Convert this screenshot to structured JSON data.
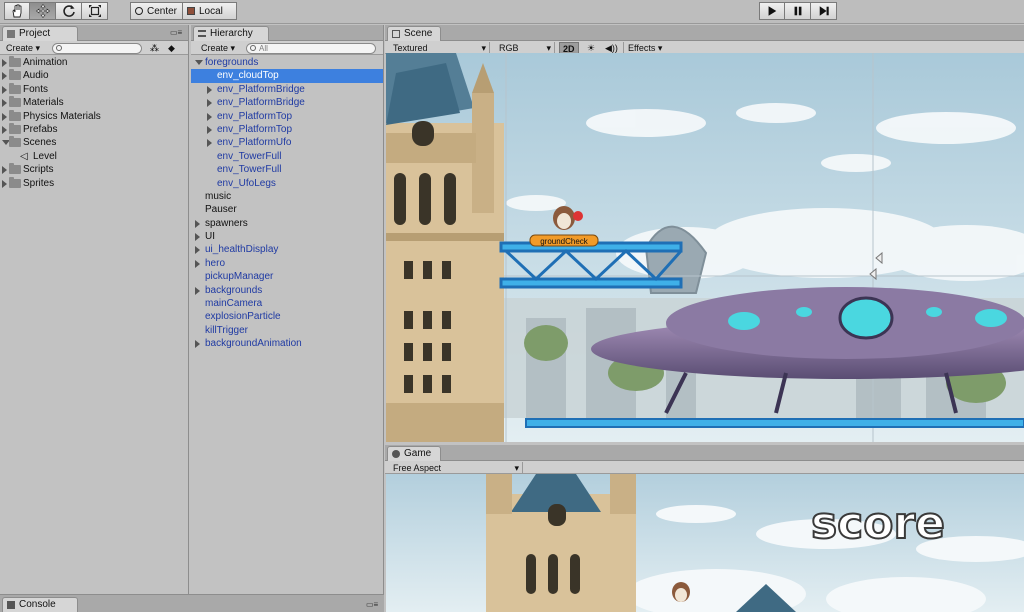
{
  "toolbar": {
    "pivot_label": "Center",
    "space_label": "Local",
    "tools": [
      "hand-icon",
      "move-icon",
      "rotate-icon",
      "scale-icon"
    ],
    "play_controls": [
      "play-icon",
      "pause-icon",
      "step-icon"
    ]
  },
  "project": {
    "tab_label": "Project",
    "create_label": "Create",
    "items": [
      {
        "label": "Animation",
        "kind": "folder",
        "expanded": false
      },
      {
        "label": "Audio",
        "kind": "folder",
        "expanded": false
      },
      {
        "label": "Fonts",
        "kind": "folder",
        "expanded": false
      },
      {
        "label": "Materials",
        "kind": "folder",
        "expanded": false
      },
      {
        "label": "Physics Materials",
        "kind": "folder",
        "expanded": false
      },
      {
        "label": "Prefabs",
        "kind": "folder",
        "expanded": false
      },
      {
        "label": "Scenes",
        "kind": "folder",
        "expanded": true
      },
      {
        "label": "Level",
        "kind": "scene",
        "expanded": false
      },
      {
        "label": "Scripts",
        "kind": "folder",
        "expanded": false
      },
      {
        "label": "Sprites",
        "kind": "folder",
        "expanded": false
      }
    ]
  },
  "hierarchy": {
    "tab_label": "Hierarchy",
    "create_label": "Create",
    "search_placeholder": "All",
    "items": [
      {
        "label": "foregrounds",
        "arrow": "down",
        "indent": 0,
        "blue": true,
        "selected": false
      },
      {
        "label": "env_cloudTop",
        "arrow": "",
        "indent": 1,
        "blue": true,
        "selected": true
      },
      {
        "label": "env_PlatformBridge",
        "arrow": "right",
        "indent": 1,
        "blue": true,
        "selected": false
      },
      {
        "label": "env_PlatformBridge",
        "arrow": "right",
        "indent": 1,
        "blue": true,
        "selected": false
      },
      {
        "label": "env_PlatformTop",
        "arrow": "right",
        "indent": 1,
        "blue": true,
        "selected": false
      },
      {
        "label": "env_PlatformTop",
        "arrow": "right",
        "indent": 1,
        "blue": true,
        "selected": false
      },
      {
        "label": "env_PlatformUfo",
        "arrow": "right",
        "indent": 1,
        "blue": true,
        "selected": false
      },
      {
        "label": "env_TowerFull",
        "arrow": "",
        "indent": 1,
        "blue": true,
        "selected": false
      },
      {
        "label": "env_TowerFull",
        "arrow": "",
        "indent": 1,
        "blue": true,
        "selected": false
      },
      {
        "label": "env_UfoLegs",
        "arrow": "",
        "indent": 1,
        "blue": true,
        "selected": false
      },
      {
        "label": "music",
        "arrow": "",
        "indent": 0,
        "blue": false,
        "selected": false
      },
      {
        "label": "Pauser",
        "arrow": "",
        "indent": 0,
        "blue": false,
        "selected": false
      },
      {
        "label": "spawners",
        "arrow": "right",
        "indent": 0,
        "blue": false,
        "selected": false
      },
      {
        "label": "UI",
        "arrow": "right",
        "indent": 0,
        "blue": false,
        "selected": false
      },
      {
        "label": "ui_healthDisplay",
        "arrow": "right",
        "indent": 0,
        "blue": true,
        "selected": false
      },
      {
        "label": "hero",
        "arrow": "right",
        "indent": 0,
        "blue": true,
        "selected": false
      },
      {
        "label": "pickupManager",
        "arrow": "",
        "indent": 0,
        "blue": true,
        "selected": false
      },
      {
        "label": "backgrounds",
        "arrow": "right",
        "indent": 0,
        "blue": true,
        "selected": false
      },
      {
        "label": "mainCamera",
        "arrow": "",
        "indent": 0,
        "blue": true,
        "selected": false
      },
      {
        "label": "explosionParticle",
        "arrow": "",
        "indent": 0,
        "blue": true,
        "selected": false
      },
      {
        "label": "killTrigger",
        "arrow": "",
        "indent": 0,
        "blue": true,
        "selected": false
      },
      {
        "label": "backgroundAnimation",
        "arrow": "right",
        "indent": 0,
        "blue": true,
        "selected": false
      }
    ]
  },
  "scene": {
    "tab_label": "Scene",
    "render_mode": "Textured",
    "color_mode": "RGB",
    "mode_2d": "2D",
    "effects_label": "Effects",
    "ground_check_label": "groundCheck"
  },
  "game": {
    "tab_label": "Game",
    "aspect_label": "Free Aspect",
    "score_text": "score"
  },
  "console": {
    "tab_label": "Console"
  },
  "colors": {
    "selection": "#3d80df",
    "prefab_blue": "#1f3aa3",
    "panel": "#c2c2c2"
  }
}
